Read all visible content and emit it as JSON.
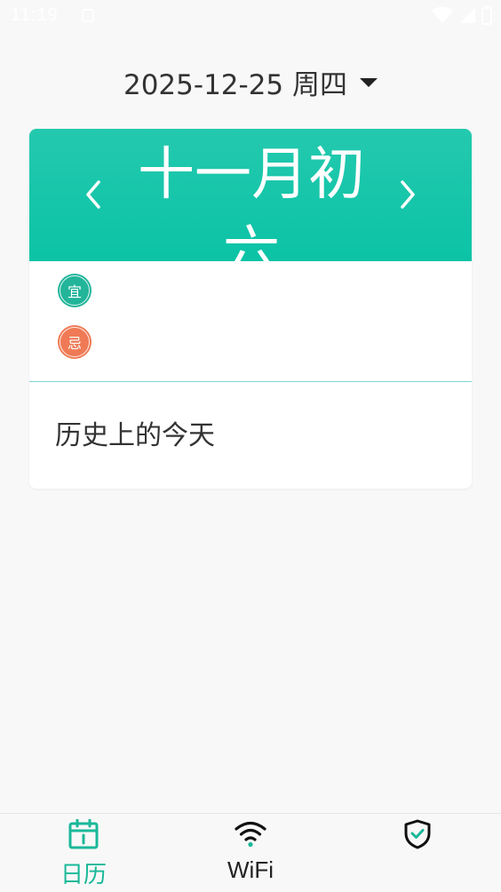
{
  "status_bar": {
    "time": "11:19"
  },
  "header": {
    "date": "2025-12-25 周四"
  },
  "card": {
    "lunar_date": "十一月初六",
    "yi_badge": "宜",
    "yi_value": "",
    "ji_badge": "忌",
    "ji_value": "",
    "history_title": "历史上的今天"
  },
  "bottom_nav": {
    "items": [
      {
        "label": "日历",
        "icon": "calendar-icon",
        "active": true
      },
      {
        "label": "WiFi",
        "icon": "wifi-icon",
        "active": false
      },
      {
        "label": "",
        "icon": "shield-check-icon",
        "active": false
      }
    ]
  },
  "colors": {
    "accent": "#1ab899",
    "header_gradient_top": "#24c9ae",
    "header_gradient_bottom": "#0bc3a6",
    "yi_color": "#22b59a",
    "ji_color": "#ef7a55"
  }
}
